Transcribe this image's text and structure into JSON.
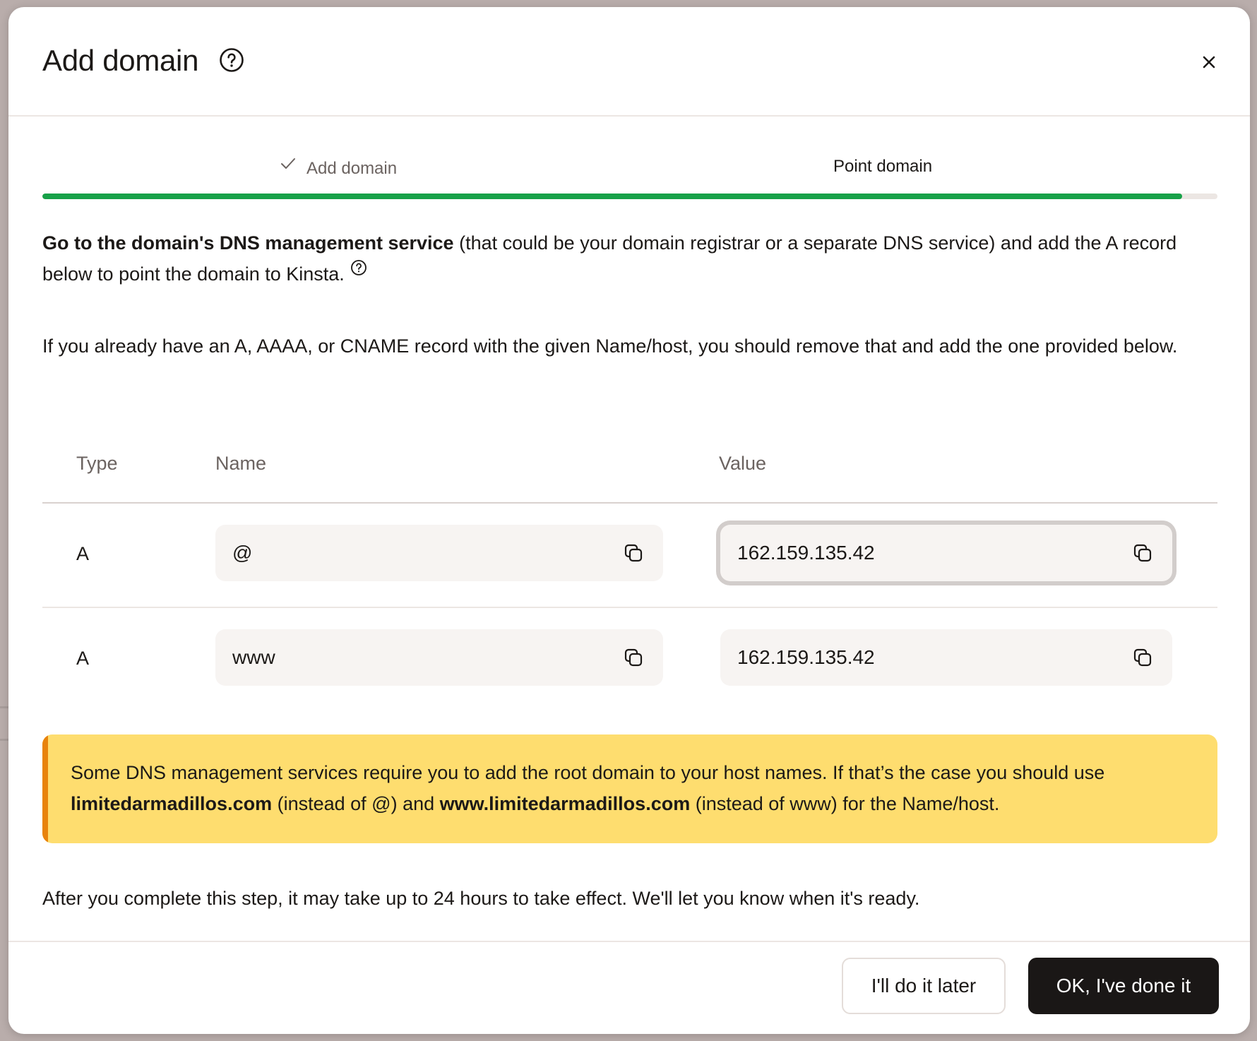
{
  "modal": {
    "title": "Add domain",
    "help_icon": "question-circle-icon",
    "close_icon": "close-icon"
  },
  "stepper": {
    "steps": [
      {
        "label": "Add domain",
        "state": "completed",
        "icon": "check-icon"
      },
      {
        "label": "Point domain",
        "state": "current"
      }
    ],
    "progress_percent": 97,
    "progress_color": "#17a148"
  },
  "instructions": {
    "p1_bold": "Go to the domain's DNS management service",
    "p1_rest": " (that could be your domain registrar or a separate DNS service) and add the A record below to point the domain to Kinsta.",
    "p2": "If you already have an A, AAAA, or CNAME record with the given Name/host, you should remove that and add the one provided below."
  },
  "dns_table": {
    "columns": [
      "Type",
      "Name",
      "Value"
    ],
    "rows": [
      {
        "type": "A",
        "name": "@",
        "value": "162.159.135.42"
      },
      {
        "type": "A",
        "name": "www",
        "value": "162.159.135.42"
      }
    ],
    "copy_icon": "copy-icon"
  },
  "notice": {
    "text_1": "Some DNS management services require you to add the root domain to your host names. If that’s the case you should use ",
    "bold_1": "limitedarmadillos.com",
    "text_2": " (instead of @) and ",
    "bold_2": "www.limitedarmadillos.com",
    "text_3": " (instead of www) for the Name/host.",
    "background": "#fedd6f",
    "accent": "#e8830c"
  },
  "footer_note": "After you complete this step, it may take up to 24 hours to take effect. We'll let you know when it's ready.",
  "footer": {
    "secondary_label": "I'll do it later",
    "primary_label": "OK, I've done it"
  }
}
